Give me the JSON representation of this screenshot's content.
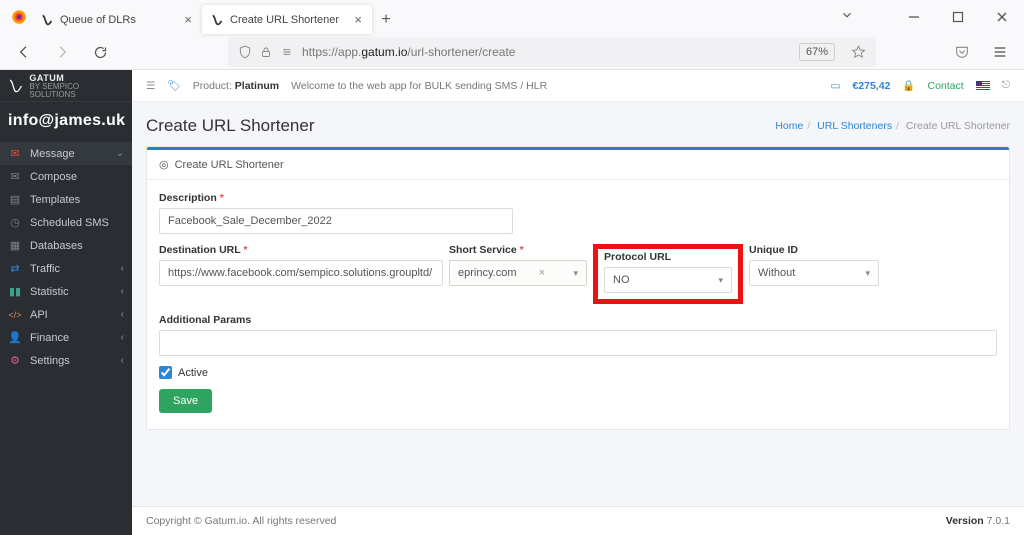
{
  "browser": {
    "tabs": [
      {
        "title": "Queue of DLRs",
        "active": false
      },
      {
        "title": "Create URL Shortener",
        "active": true
      }
    ],
    "url_prefix": "https://app.",
    "url_host": "gatum.io",
    "url_path": "/url-shortener/create",
    "zoom": "67%"
  },
  "sidebar": {
    "brand": "GATUM",
    "brand_sub": "BY SEMPICO SOLUTIONS",
    "user": "info@james.uk",
    "items": [
      {
        "label": "Message",
        "active": true,
        "chev": "⌄",
        "icon": "✉"
      },
      {
        "label": "Compose",
        "icon": "✉"
      },
      {
        "label": "Templates",
        "icon": "📄"
      },
      {
        "label": "Scheduled SMS",
        "icon": "🕒"
      },
      {
        "label": "Databases",
        "icon": "🗄"
      },
      {
        "label": "Traffic",
        "chev": "‹",
        "icon": "⇄"
      },
      {
        "label": "Statistic",
        "chev": "‹",
        "icon": "📊"
      },
      {
        "label": "API",
        "chev": "‹",
        "icon": "</>"
      },
      {
        "label": "Finance",
        "chev": "‹",
        "icon": "👤"
      },
      {
        "label": "Settings",
        "chev": "‹",
        "icon": "⚙"
      }
    ]
  },
  "topbar": {
    "product_label": "Product:",
    "product_value": "Platinum",
    "welcome": "Welcome to the web app for BULK sending SMS / HLR",
    "balance": "€275,42",
    "contact": "Contact"
  },
  "page": {
    "title": "Create URL Shortener",
    "breadcrumb": {
      "home": "Home",
      "mid": "URL Shorteners",
      "cur": "Create URL Shortener"
    },
    "panel_title": "Create URL Shortener"
  },
  "form": {
    "description_label": "Description",
    "description_value": "Facebook_Sale_December_2022",
    "dest_label": "Destination URL",
    "dest_value": "https://www.facebook.com/sempico.solutions.groupltd/",
    "short_label": "Short Service",
    "short_value": "eprincy.com",
    "protocol_label": "Protocol URL",
    "protocol_value": "NO",
    "unique_label": "Unique ID",
    "unique_value": "Without",
    "additional_label": "Additional Params",
    "additional_value": "",
    "active_label": "Active",
    "save": "Save"
  },
  "footer": {
    "copyright": "Copyright © Gatum.io. All rights reserved",
    "version_label": "Version",
    "version": "7.0.1"
  }
}
